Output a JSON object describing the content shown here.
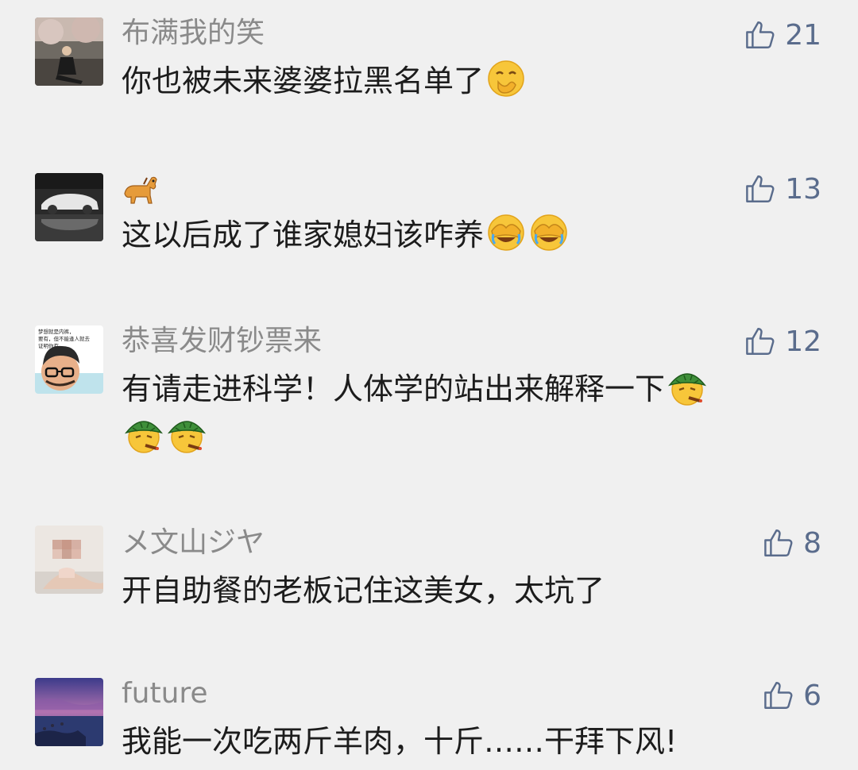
{
  "comments": [
    {
      "name": "布满我的笑",
      "text": "你也被未来婆婆拉黑名单了",
      "emojis": [
        "hand-over-mouth-emoji"
      ],
      "likes": "21"
    },
    {
      "name": "",
      "name_icon": "horse-emoji",
      "text": "这以后成了谁家媳妇该咋养",
      "emojis": [
        "facepalm-laugh-emoji",
        "facepalm-laugh-emoji"
      ],
      "likes": "13"
    },
    {
      "name": "恭喜发财钞票来",
      "text": "有请走进科学！人体学的站出来解释一下",
      "emojis": [
        "turtle-hat-emoji",
        "turtle-hat-emoji",
        "turtle-hat-emoji"
      ],
      "likes": "12",
      "avatar_text": [
        "梦想就是内裤，",
        "要有，但不能逢人就去",
        "证明你有……"
      ]
    },
    {
      "name": "メ文山ジヤ",
      "text": "开自助餐的老板记住这美女，太坑了",
      "emojis": [],
      "likes": "8"
    },
    {
      "name": "future",
      "text": "我能一次吃两斤羊肉，十斤……干拜下风!",
      "emojis": [],
      "likes": "6"
    }
  ],
  "colors": {
    "background": "#f0f0f0",
    "name": "#8a8a8a",
    "like": "#5a6c8c"
  }
}
